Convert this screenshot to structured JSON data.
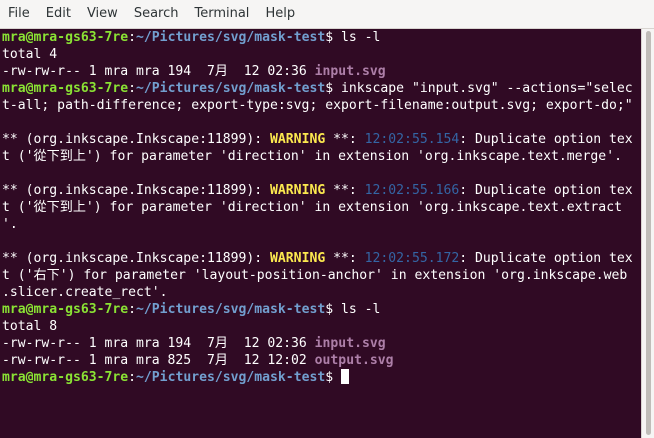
{
  "menubar": {
    "items": [
      "File",
      "Edit",
      "View",
      "Search",
      "Terminal",
      "Help"
    ]
  },
  "terminal": {
    "lines": [
      [
        {
          "t": "mra@mra-gs63-7re",
          "c": "prompt"
        },
        {
          "t": ":",
          "c": ""
        },
        {
          "t": "~/Pictures/svg/mask-test",
          "c": "path"
        },
        {
          "t": "$ ls -l",
          "c": ""
        }
      ],
      [
        {
          "t": "total 4",
          "c": ""
        }
      ],
      [
        {
          "t": "-rw-rw-r-- 1 mra mra 194  7月  12 02:36 ",
          "c": ""
        },
        {
          "t": "input.svg",
          "c": "file"
        }
      ],
      [
        {
          "t": "mra@mra-gs63-7re",
          "c": "prompt"
        },
        {
          "t": ":",
          "c": ""
        },
        {
          "t": "~/Pictures/svg/mask-test",
          "c": "path"
        },
        {
          "t": "$ inkscape \"input.svg\" --actions=\"selec",
          "c": ""
        }
      ],
      [
        {
          "t": "t-all; path-difference; export-type:svg; export-filename:output.svg; export-do;\"",
          "c": ""
        }
      ],
      [
        {
          "t": "",
          "c": ""
        }
      ],
      [
        {
          "t": "** (org.inkscape.Inkscape:11899): ",
          "c": ""
        },
        {
          "t": "WARNING",
          "c": "warn"
        },
        {
          "t": " **: ",
          "c": ""
        },
        {
          "t": "12:02:55.154",
          "c": "time"
        },
        {
          "t": ": Duplicate option tex",
          "c": ""
        }
      ],
      [
        {
          "t": "t ('從下到上') for parameter 'direction' in extension 'org.inkscape.text.merge'.",
          "c": ""
        }
      ],
      [
        {
          "t": "",
          "c": ""
        }
      ],
      [
        {
          "t": "** (org.inkscape.Inkscape:11899): ",
          "c": ""
        },
        {
          "t": "WARNING",
          "c": "warn"
        },
        {
          "t": " **: ",
          "c": ""
        },
        {
          "t": "12:02:55.166",
          "c": "time"
        },
        {
          "t": ": Duplicate option tex",
          "c": ""
        }
      ],
      [
        {
          "t": "t ('從下到上') for parameter 'direction' in extension 'org.inkscape.text.extract",
          "c": ""
        }
      ],
      [
        {
          "t": "'.",
          "c": ""
        }
      ],
      [
        {
          "t": "",
          "c": ""
        }
      ],
      [
        {
          "t": "** (org.inkscape.Inkscape:11899): ",
          "c": ""
        },
        {
          "t": "WARNING",
          "c": "warn"
        },
        {
          "t": " **: ",
          "c": ""
        },
        {
          "t": "12:02:55.172",
          "c": "time"
        },
        {
          "t": ": Duplicate option tex",
          "c": ""
        }
      ],
      [
        {
          "t": "t ('右下') for parameter 'layout-position-anchor' in extension 'org.inkscape.web",
          "c": ""
        }
      ],
      [
        {
          "t": ".slicer.create_rect'.",
          "c": ""
        }
      ],
      [
        {
          "t": "mra@mra-gs63-7re",
          "c": "prompt"
        },
        {
          "t": ":",
          "c": ""
        },
        {
          "t": "~/Pictures/svg/mask-test",
          "c": "path"
        },
        {
          "t": "$ ls -l",
          "c": ""
        }
      ],
      [
        {
          "t": "total 8",
          "c": ""
        }
      ],
      [
        {
          "t": "-rw-rw-r-- 1 mra mra 194  7月  12 02:36 ",
          "c": ""
        },
        {
          "t": "input.svg",
          "c": "file"
        }
      ],
      [
        {
          "t": "-rw-rw-r-- 1 mra mra 825  7月  12 12:02 ",
          "c": ""
        },
        {
          "t": "output.svg",
          "c": "file"
        }
      ],
      [
        {
          "t": "mra@mra-gs63-7re",
          "c": "prompt"
        },
        {
          "t": ":",
          "c": ""
        },
        {
          "t": "~/Pictures/svg/mask-test",
          "c": "path"
        },
        {
          "t": "$ ",
          "c": ""
        },
        {
          "t": "",
          "c": "cursor"
        }
      ]
    ]
  },
  "colors": {
    "terminal_bg": "#300a24",
    "prompt": "#8ae234",
    "path": "#729fcf",
    "warning": "#fce94f",
    "timestamp": "#3465a4",
    "file": "#ad7fa8"
  }
}
